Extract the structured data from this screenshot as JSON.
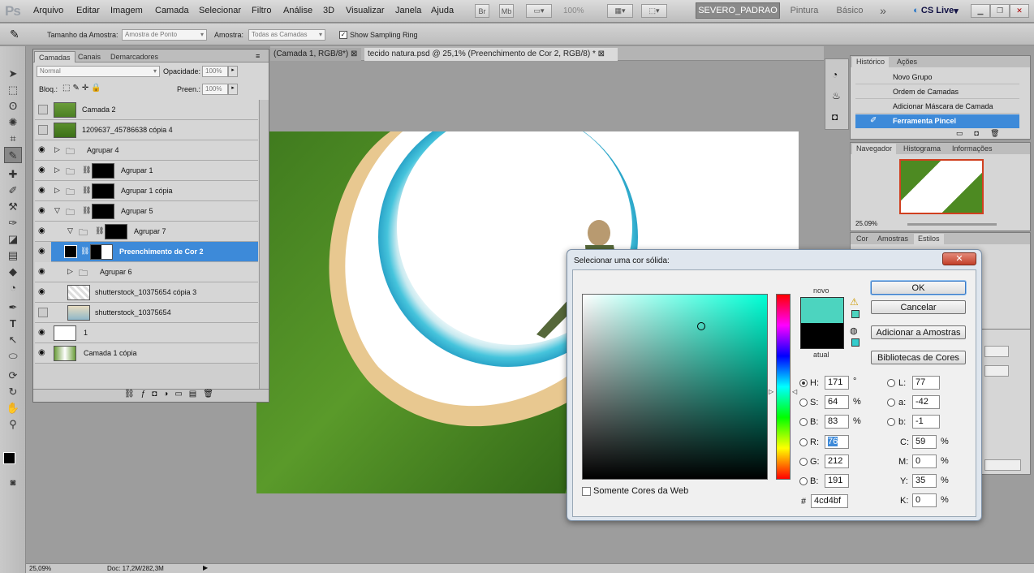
{
  "menu": {
    "logo": "Ps",
    "items": [
      "Arquivo",
      "Editar",
      "Imagem",
      "Camada",
      "Selecionar",
      "Filtro",
      "Análise",
      "3D",
      "Visualizar",
      "Janela",
      "Ajuda"
    ],
    "zoom": "100%",
    "workspace_active": "SEVERO_PADRAO",
    "workspace_2": "Pintura",
    "workspace_3": "Básico",
    "more": "»",
    "cslive": "CS Live"
  },
  "options": {
    "sample_size_label": "Tamanho da Amostra:",
    "sample_size_value": "Amostra de Ponto",
    "sample_label": "Amostra:",
    "sample_value": "Todas as Camadas",
    "show_ring": "Show Sampling Ring"
  },
  "doc_tabs": [
    "(Camada 1, RGB/8*)",
    "tecido natura.psd @ 25,1% (Preenchimento de Cor 2, RGB/8) *"
  ],
  "layers_panel": {
    "tabs": [
      "Camadas",
      "Canais",
      "Demarcadores"
    ],
    "blend_mode": "Normal",
    "opacity_label": "Opacidade:",
    "opacity_value": "100%",
    "lock_label": "Bloq.:",
    "fill_label": "Preen.:",
    "fill_value": "100%",
    "layers": [
      {
        "name": "Camada 2",
        "visible": false
      },
      {
        "name": "1209637_45786638 cópia 4",
        "visible": false
      },
      {
        "name": "Agrupar 4",
        "visible": true
      },
      {
        "name": "Agrupar 1",
        "visible": true
      },
      {
        "name": "Agrupar 1 cópia",
        "visible": true
      },
      {
        "name": "Agrupar 5",
        "visible": true
      },
      {
        "name": "Agrupar 7",
        "visible": true
      },
      {
        "name": "Preenchimento de Cor 2",
        "visible": true
      },
      {
        "name": "Agrupar 6",
        "visible": true
      },
      {
        "name": "shutterstock_10375654 cópia 3",
        "visible": true
      },
      {
        "name": "shutterstock_10375654",
        "visible": false
      },
      {
        "name": "1",
        "visible": true
      },
      {
        "name": "Camada 1 cópia",
        "visible": true
      }
    ]
  },
  "history": {
    "tabs": [
      "Histórico",
      "Ações"
    ],
    "items": [
      "Novo Grupo",
      "Ordem de Camadas",
      "Adicionar Máscara de Camada",
      "Ferramenta Pincel"
    ]
  },
  "navigator": {
    "tabs": [
      "Navegador",
      "Histograma",
      "Informações"
    ],
    "zoom": "25.09%"
  },
  "color_panel": {
    "tabs": [
      "Cor",
      "Amostras",
      "Estilos"
    ]
  },
  "picker": {
    "title": "Selecionar uma cor sólida:",
    "ok": "OK",
    "cancel": "Cancelar",
    "add_swatch": "Adicionar a Amostras",
    "libraries": "Bibliotecas de Cores",
    "new_label": "novo",
    "current_label": "atual",
    "web_only": "Somente Cores da Web",
    "new_color": "#4cd4bf",
    "current_color": "#000000",
    "H": "171",
    "H_unit": "°",
    "S": "64",
    "S_unit": "%",
    "B": "83",
    "B_unit": "%",
    "R": "76",
    "G": "212",
    "Bv": "191",
    "L": "77",
    "a": "-42",
    "b": "-1",
    "C": "59",
    "M": "0",
    "Y": "35",
    "K": "0",
    "pct": "%",
    "hex": "4cd4bf",
    "hash": "#",
    "lab_H": "H:",
    "lab_S": "S:",
    "lab_B": "B:",
    "lab_R": "R:",
    "lab_G": "G:",
    "lab_Bb": "B:",
    "lab_L": "L:",
    "lab_a": "a:",
    "lab_b": "b:",
    "lab_C": "C:",
    "lab_M": "M:",
    "lab_Y": "Y:",
    "lab_K": "K:"
  },
  "status": {
    "zoom": "25,09%",
    "doc": "Doc: 17,2M/282,3M"
  }
}
